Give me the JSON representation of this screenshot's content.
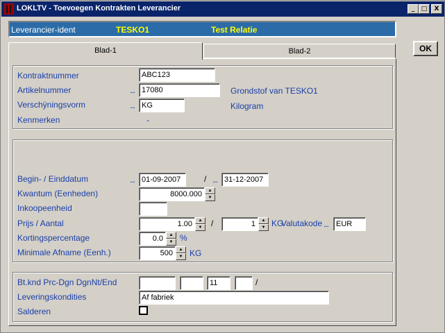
{
  "window": {
    "title": "LOKLTV - Toevoegen Kontrakten Leverancier",
    "minimize": "_",
    "maximize": "□",
    "close": "X"
  },
  "header": {
    "label": "Leverancier-ident",
    "code": "TESKO1",
    "name": "Test Relatie"
  },
  "ok_label": "OK",
  "tabs": [
    {
      "label": "Blad-1"
    },
    {
      "label": "Blad-2"
    }
  ],
  "group1": {
    "kontraktnummer": {
      "label": "Kontraktnummer",
      "value": "ABC123"
    },
    "artikelnummer": {
      "label": "Artikelnummer",
      "value": "17080",
      "desc": "Grondstof van TESKO1"
    },
    "verschijningsvorm": {
      "label": "Verschÿningsvorm",
      "value": "KG",
      "desc": "Kilogram"
    },
    "kenmerken": {
      "label": "Kenmerken",
      "value": "-"
    }
  },
  "group2": {
    "datum": {
      "label": "Begin- / Einddatum",
      "begin": "01-09-2007",
      "sep": "/",
      "end": "31-12-2007"
    },
    "kwantum": {
      "label": "Kwantum (Eenheden)",
      "value": "8000.000"
    },
    "inkoopeenheid": {
      "label": "Inkoopeenheid",
      "value": ""
    },
    "prijs": {
      "label": "Prijs / Aantal",
      "price": "1.00",
      "sep": "/",
      "qty": "1",
      "unit": "KG",
      "valuta_label": "Valutakode",
      "valuta": "EUR"
    },
    "korting": {
      "label": "Kortingspercentage",
      "value": "0.0",
      "unit": "%"
    },
    "minimale": {
      "label": "Minimale Afname (Eenh.)",
      "value": "500",
      "unit": "KG"
    }
  },
  "group3": {
    "btknd": {
      "label": "Bt.knd Prc-Dgn DgnNt/End",
      "f1": "",
      "f2": "",
      "f3": "11",
      "f4": "",
      "sep": "/"
    },
    "levering": {
      "label": "Leveringskondities",
      "value": "Af fabriek"
    },
    "salderen": {
      "label": "Salderen",
      "checked": false
    }
  },
  "ellipsis": "...",
  "spin_up": "▲",
  "spin_down": "▼"
}
